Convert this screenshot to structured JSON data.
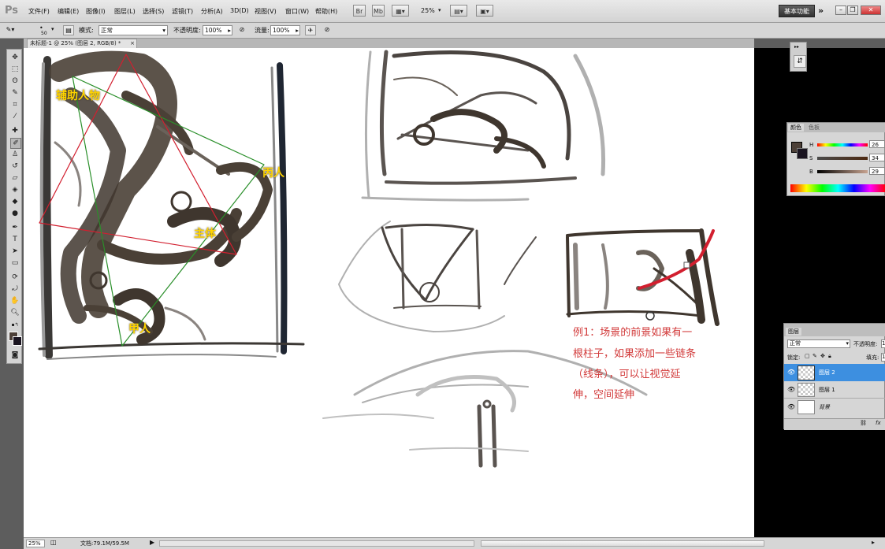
{
  "app": {
    "logo": "Ps"
  },
  "menu": [
    "文件(F)",
    "编辑(E)",
    "图像(I)",
    "图层(L)",
    "选择(S)",
    "滤镜(T)",
    "分析(A)",
    "3D(D)",
    "视图(V)",
    "窗口(W)",
    "帮助(H)"
  ],
  "topbar": {
    "btn_br": "Br",
    "btn_mb": "Mb",
    "zoom": "25%",
    "workspace": "基本功能",
    "more": "»"
  },
  "options": {
    "brush_size": "50",
    "mode_label": "模式:",
    "mode_value": "正常",
    "opacity_label": "不透明度:",
    "opacity_value": "100%",
    "flow_label": "流量:",
    "flow_value": "100%"
  },
  "document": {
    "tab_title": "未标题-1 @ 25% (图层 2, RGB/8) *",
    "close": "×"
  },
  "canvas_labels": {
    "aux": "辅助人物",
    "bing": "丙人",
    "main": "主体",
    "jia": "甲人"
  },
  "note_lines": [
    "例1：场景的前景如果有一",
    "根柱子，如果添加一些链条",
    "（线条），可以让视觉延",
    "伸，空间延伸"
  ],
  "status": {
    "zoom": "25%",
    "doc": "文档:79.1M/59.5M"
  },
  "color_panel": {
    "tabs": [
      "颜色",
      "色板"
    ],
    "rows": [
      {
        "label": "H",
        "value": "26"
      },
      {
        "label": "S",
        "value": "34"
      },
      {
        "label": "B",
        "value": "29"
      }
    ],
    "fg_color": "#4d4038",
    "bg_color": "#1a1420"
  },
  "layers_panel": {
    "tab": "图层",
    "blend_mode": "正常",
    "opacity_label": "不透明度:",
    "opacity_value": "1",
    "lock_label": "锁定:",
    "fill_label": "填充:",
    "fill_value": "1",
    "layers": [
      {
        "name": "图层 2",
        "selected": true
      },
      {
        "name": "图层 1",
        "selected": false
      },
      {
        "name": "背景",
        "selected": false
      }
    ],
    "footer": "fx"
  },
  "colors": {
    "accent_blue": "#3d8fe0",
    "note_red": "#d23a3a",
    "label_yellow": "#ffd400"
  }
}
